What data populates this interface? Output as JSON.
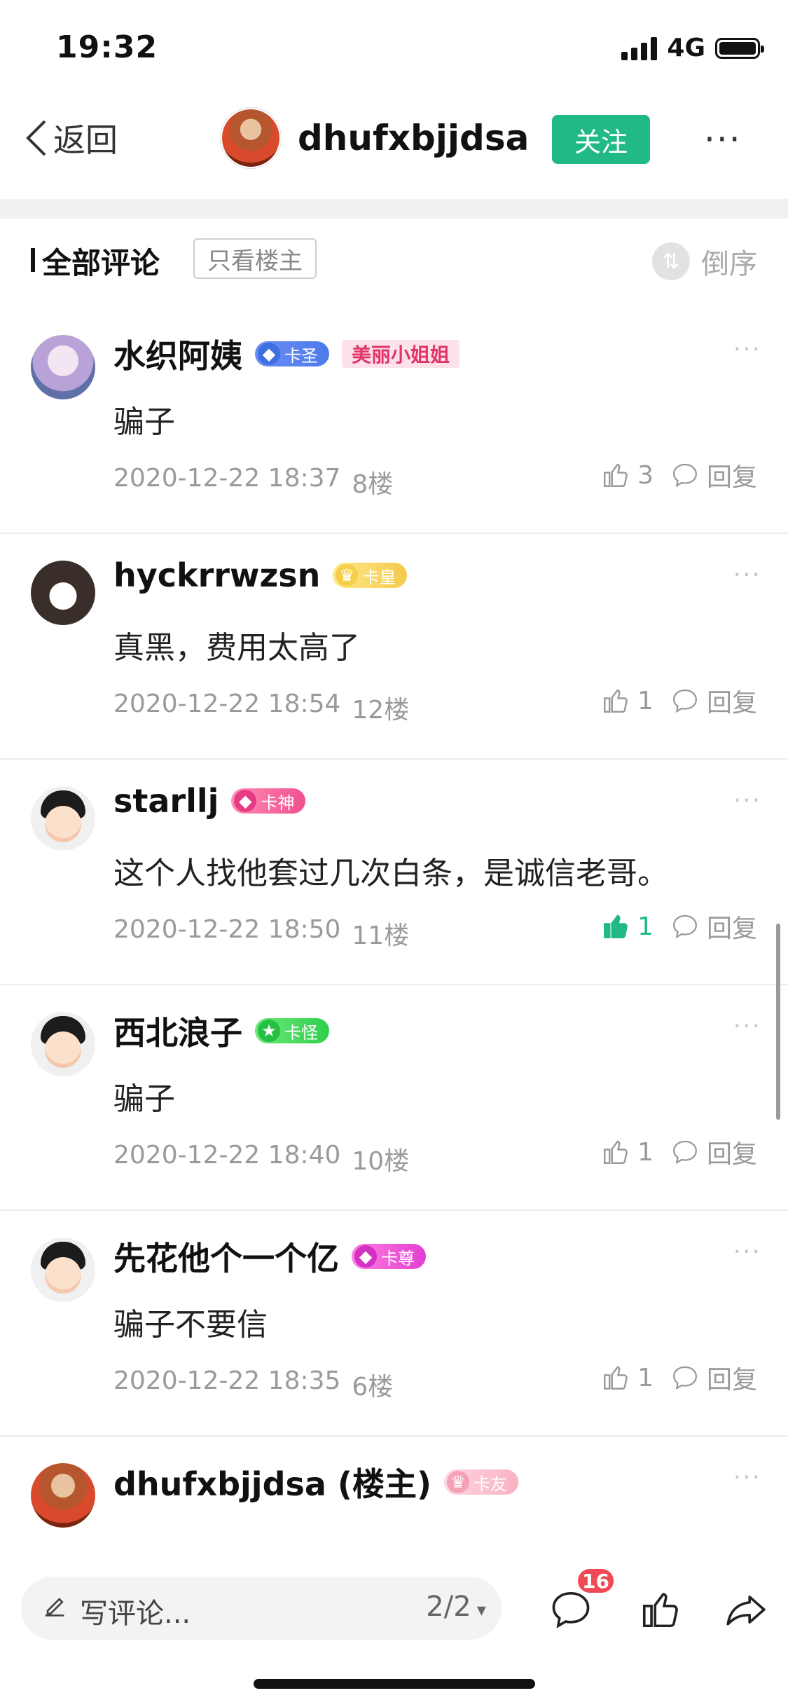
{
  "status_bar": {
    "time": "19:32",
    "network": "4G"
  },
  "nav": {
    "back_label": "返回",
    "username": "dhufxbjjdsa",
    "follow_label": "关注",
    "more_label": "···"
  },
  "section": {
    "title": "全部评论",
    "filter_label": "只看楼主",
    "sort_label": "倒序"
  },
  "comments": [
    {
      "name": "水织阿姨",
      "badge": "卡圣",
      "title_tag": "美丽小姐姐",
      "text": "骗子",
      "date": "2020-12-22 18:37",
      "floor": "8楼",
      "likes": "3",
      "reply_label": "回复",
      "liked": false
    },
    {
      "name": "hyckrrwzsn",
      "badge": "卡皇",
      "text": "真黑，费用太高了",
      "date": "2020-12-22 18:54",
      "floor": "12楼",
      "likes": "1",
      "reply_label": "回复",
      "liked": false
    },
    {
      "name": "starllj",
      "badge": "卡神",
      "text": "这个人找他套过几次白条，是诚信老哥。",
      "date": "2020-12-22 18:50",
      "floor": "11楼",
      "likes": "1",
      "reply_label": "回复",
      "liked": true
    },
    {
      "name": "西北浪子",
      "badge": "卡怪",
      "text": "骗子",
      "date": "2020-12-22 18:40",
      "floor": "10楼",
      "likes": "1",
      "reply_label": "回复",
      "liked": false
    },
    {
      "name": "先花他个一个亿",
      "badge": "卡尊",
      "text": "骗子不要信",
      "date": "2020-12-22 18:35",
      "floor": "6楼",
      "likes": "1",
      "reply_label": "回复",
      "liked": false
    },
    {
      "name": "dhufxbjjdsa (楼主)",
      "badge": "卡友"
    }
  ],
  "bottom_bar": {
    "placeholder": "写评论...",
    "page": "2/2",
    "comment_count": "16"
  },
  "colors": {
    "accent": "#21b986",
    "badge_red": "#f24957"
  }
}
